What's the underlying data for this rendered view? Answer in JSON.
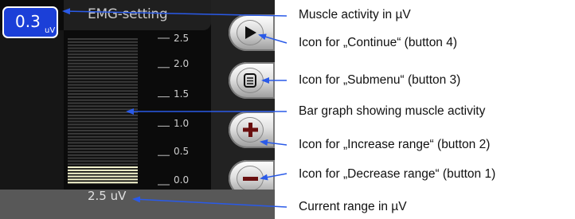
{
  "screen": {
    "title": "EMG-setting",
    "value": "0.3",
    "value_unit": "uV",
    "range_text": "2.5 uV"
  },
  "scale": {
    "ticks": [
      "2.5",
      "2.0",
      "1.5",
      "1.0",
      "0.5",
      "0.0"
    ],
    "max": 2.5,
    "current_value": 0.3
  },
  "buttons": [
    {
      "id": "continue",
      "icon": "play-icon"
    },
    {
      "id": "submenu",
      "icon": "menu-list-icon"
    },
    {
      "id": "increase",
      "icon": "plus-icon"
    },
    {
      "id": "decrease",
      "icon": "minus-icon"
    }
  ],
  "annotations": [
    "Muscle activity in µV",
    "Icon for „Continue“ (button 4)",
    "Icon for „Submenu“ (button 3)",
    "Bar graph showing muscle activity",
    "Icon for „Increase range“ (button 2)",
    "Icon for „Decrease range“ (button 1)",
    "Current range in µV"
  ],
  "colors": {
    "value_box": "#1b3fd8",
    "arrow": "#2a5ae8",
    "bar_active": "#f2f2cc",
    "bar_inactive": "#3a3a3a"
  }
}
